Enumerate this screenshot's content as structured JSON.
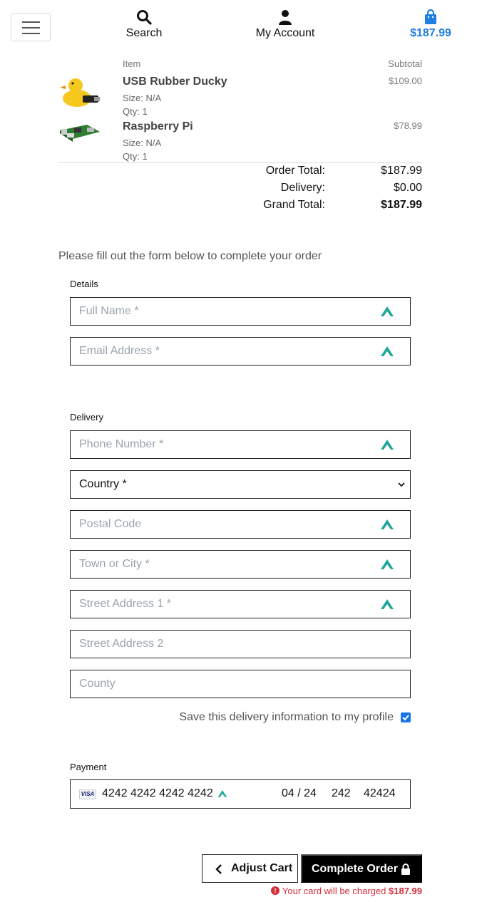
{
  "header": {
    "search_label": "Search",
    "account_label": "My Account",
    "cart_total": "$187.99",
    "accent_color": "#1e7fe0"
  },
  "cart": {
    "col_item": "Item",
    "col_subtotal": "Subtotal",
    "items": [
      {
        "name": "USB Rubber Ducky",
        "size": "Size: N/A",
        "qty": "Qty: 1",
        "subtotal": "$109.00",
        "image": "rubber-duck-usb"
      },
      {
        "name": "Raspberry Pi",
        "size": "Size: N/A",
        "qty": "Qty: 1",
        "subtotal": "$78.99",
        "image": "raspberry-pi-board"
      }
    ]
  },
  "totals": {
    "order_total_label": "Order Total:",
    "order_total": "$187.99",
    "delivery_label": "Delivery:",
    "delivery": "$0.00",
    "grand_total_label": "Grand Total:",
    "grand_total": "$187.99"
  },
  "form": {
    "intro": "Please fill out the form below to complete your order",
    "details_label": "Details",
    "full_name_placeholder": "Full Name *",
    "email_placeholder": "Email Address *",
    "delivery_label": "Delivery",
    "phone_placeholder": "Phone Number *",
    "country_selected": "Country *",
    "postal_placeholder": "Postal Code",
    "town_placeholder": "Town or City *",
    "street1_placeholder": "Street Address 1 *",
    "street2_placeholder": "Street Address 2",
    "county_placeholder": "County",
    "save_info_label": "Save this delivery information to my profile",
    "save_info_checked": true,
    "payment_label": "Payment",
    "card_brand": "VISA",
    "card_number": "4242 4242 4242 4242",
    "card_expiry": "04 / 24",
    "card_cvc": "242",
    "card_postal": "42424"
  },
  "actions": {
    "adjust_cart_label": "Adjust Cart",
    "complete_order_label": "Complete Order",
    "charge_notice_prefix": "Your card will be charged",
    "charge_amount": "$187.99",
    "error_color": "#d32f3a"
  }
}
